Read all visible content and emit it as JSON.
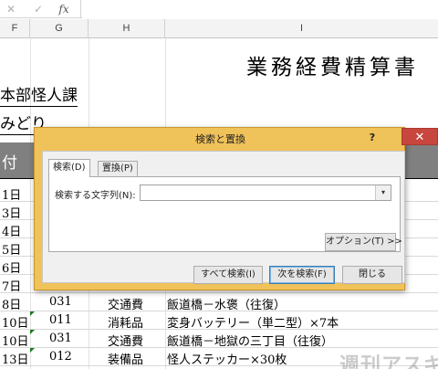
{
  "formula_bar": {
    "cancel_icon": "✕",
    "enter_icon": "✓",
    "fx_label": "fx",
    "value": ""
  },
  "columns": [
    "F",
    "G",
    "H",
    "I"
  ],
  "sheet": {
    "title": "業務経費精算書",
    "department": "本部怪人課",
    "person": "みどり",
    "header_text": "付",
    "rows": [
      {
        "date": "1日",
        "code": "",
        "type": "",
        "desc": ""
      },
      {
        "date": "3日",
        "code": "",
        "type": "",
        "desc": ""
      },
      {
        "date": "4日",
        "code": "",
        "type": "",
        "desc": ""
      },
      {
        "date": "5日",
        "code": "",
        "type": "",
        "desc": ""
      },
      {
        "date": "6日",
        "code": "",
        "type": "",
        "desc": ""
      },
      {
        "date": "7日",
        "code": "",
        "type": "",
        "desc": ""
      },
      {
        "date": "8日",
        "code": "031",
        "type": "交通費",
        "desc": "飯道橋－水褒（往復）"
      },
      {
        "date": "10日",
        "code": "011",
        "type": "消耗品",
        "desc": "変身バッテリー（単二型）×7本"
      },
      {
        "date": "10日",
        "code": "031",
        "type": "交通費",
        "desc": "飯道橋－地獄の三丁目（往復）"
      },
      {
        "date": "13日",
        "code": "012",
        "type": "装備品",
        "desc": "怪人ステッカー×30枚"
      }
    ],
    "watermark": "週刊アスキー"
  },
  "dialog": {
    "title": "検索と置換",
    "help_label": "?",
    "close_label": "✕",
    "tabs": [
      {
        "label": "検索(D)",
        "active": true
      },
      {
        "label": "置換(P)",
        "active": false
      }
    ],
    "find_label": "検索する文字列(N):",
    "find_value": "",
    "dropdown_icon": "▾",
    "options_button": "オプション(T) >>",
    "find_all_button": "すべて検索(I)",
    "find_next_button": "次を検索(F)",
    "close_button": "閉じる"
  },
  "colors": {
    "dialog_frame": "#f0c25a",
    "close_button": "#c7463d",
    "header_band": "#808080",
    "comment_marker": "#1e7a1e"
  }
}
